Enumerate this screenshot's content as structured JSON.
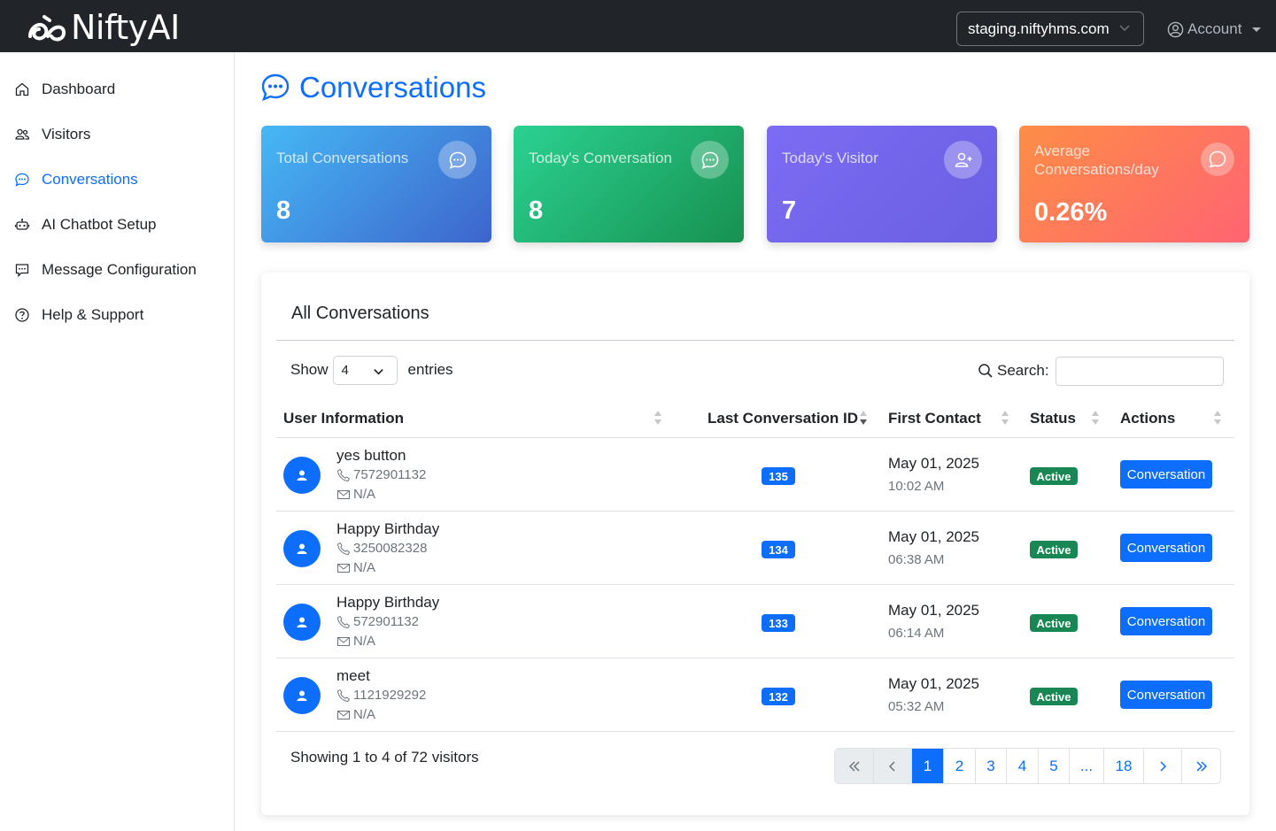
{
  "brand": {
    "name": "NiftyAI"
  },
  "topbar": {
    "domain": "staging.niftyhms.com",
    "account_label": "Account"
  },
  "sidebar": {
    "items": [
      {
        "label": "Dashboard",
        "icon": "home-icon",
        "active": false
      },
      {
        "label": "Visitors",
        "icon": "users-icon",
        "active": false
      },
      {
        "label": "Conversations",
        "icon": "chat-dots-icon",
        "active": true
      },
      {
        "label": "AI Chatbot Setup",
        "icon": "robot-icon",
        "active": false
      },
      {
        "label": "Message Configuration",
        "icon": "message-settings-icon",
        "active": false
      },
      {
        "label": "Help & Support",
        "icon": "help-icon",
        "active": false
      }
    ]
  },
  "page": {
    "title": "Conversations"
  },
  "stats": [
    {
      "label": "Total Conversations",
      "value": "8",
      "icon": "chat-dots-icon"
    },
    {
      "label": "Today's Conversation",
      "value": "8",
      "icon": "chat-dots-icon"
    },
    {
      "label": "Today's Visitor",
      "value": "7",
      "icon": "person-plus-icon"
    },
    {
      "label": "Average Conversations/day",
      "value": "0.26%",
      "icon": "chat-bubble-icon"
    }
  ],
  "table_card": {
    "title": "All Conversations",
    "show_label": "Show",
    "entries_value": "4",
    "entries_label": "entries",
    "search_label": "Search:",
    "search_value": "",
    "columns": [
      "User Information",
      "Last Conversation ID",
      "First Contact",
      "Status",
      "Actions"
    ],
    "rows": [
      {
        "name": "yes button",
        "phone": "7572901132",
        "email": "N/A",
        "conv_id": "135",
        "date": "May 01, 2025",
        "time": "10:02 AM",
        "status": "Active",
        "action": "Conversation"
      },
      {
        "name": "Happy Birthday",
        "phone": "3250082328",
        "email": "N/A",
        "conv_id": "134",
        "date": "May 01, 2025",
        "time": "06:38 AM",
        "status": "Active",
        "action": "Conversation"
      },
      {
        "name": "Happy Birthday",
        "phone": "572901132",
        "email": "N/A",
        "conv_id": "133",
        "date": "May 01, 2025",
        "time": "06:14 AM",
        "status": "Active",
        "action": "Conversation"
      },
      {
        "name": "meet",
        "phone": "1121929292",
        "email": "N/A",
        "conv_id": "132",
        "date": "May 01, 2025",
        "time": "05:32 AM",
        "status": "Active",
        "action": "Conversation"
      }
    ],
    "showing_text": "Showing 1 to 4 of 72 visitors",
    "pagination": {
      "first": "«",
      "prev": "‹",
      "pages": [
        "1",
        "2",
        "3",
        "4",
        "5",
        "...",
        "18"
      ],
      "current_page": "1",
      "next": "›",
      "last": "»"
    }
  },
  "colors": {
    "primary": "#0d6efd",
    "success": "#198754",
    "topbar": "#212529"
  }
}
